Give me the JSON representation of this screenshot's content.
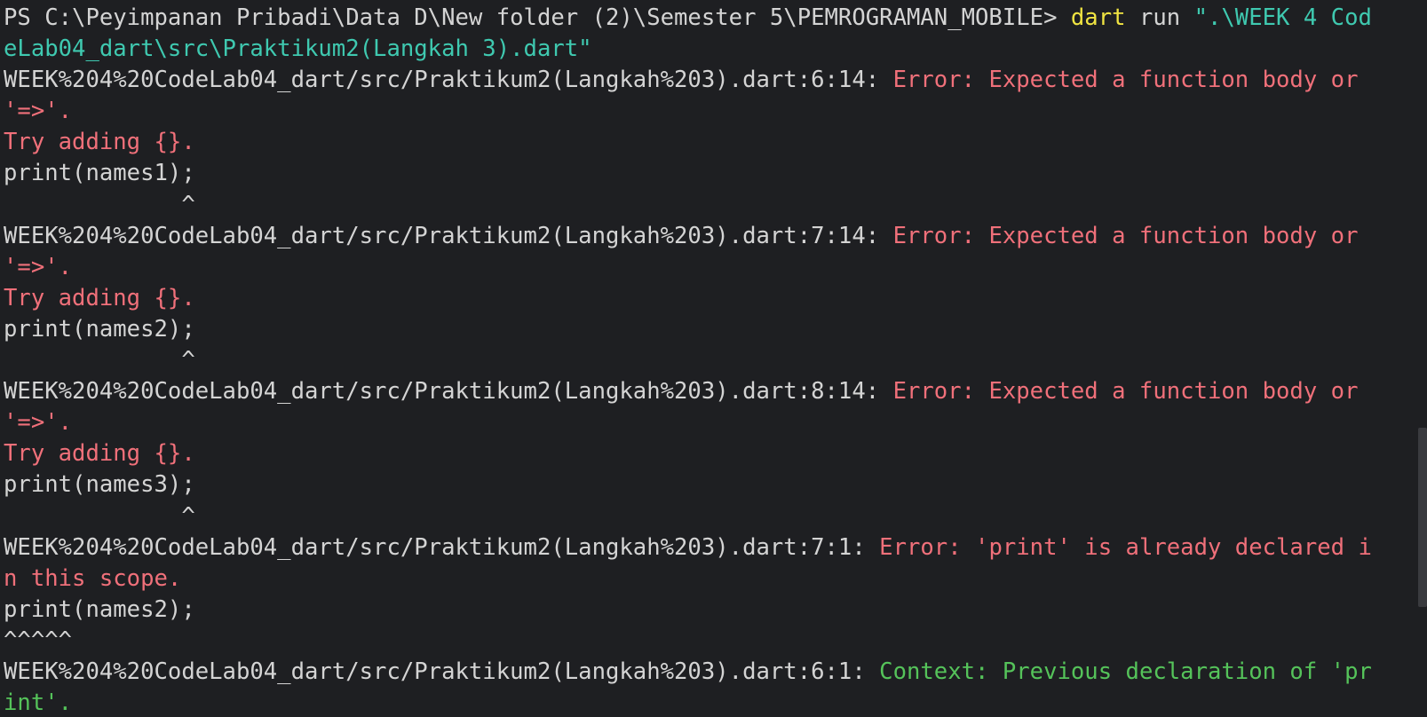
{
  "terminal": {
    "lines": [
      [
        {
          "text": "PS C:\\Peyimpanan Pribadi\\Data D\\New folder (2)\\Semester 5\\PEMROGRAMAN_MOBILE> ",
          "style": "plain"
        },
        {
          "text": "dart",
          "style": "cmd"
        },
        {
          "text": " run ",
          "style": "plain"
        },
        {
          "text": "\".\\WEEK 4 Cod",
          "style": "string"
        }
      ],
      [
        {
          "text": "eLab04_dart\\src\\Praktikum2(Langkah 3).dart\"",
          "style": "string"
        }
      ],
      [
        {
          "text": "WEEK%204%20CodeLab04_dart/src/Praktikum2(Langkah%203).dart:6:14: ",
          "style": "plain"
        },
        {
          "text": "Error: Expected a function body or",
          "style": "error"
        }
      ],
      [
        {
          "text": "'=>'.",
          "style": "error"
        }
      ],
      [
        {
          "text": "Try adding {}.",
          "style": "error"
        }
      ],
      [
        {
          "text": "print(names1);",
          "style": "plain"
        }
      ],
      [
        {
          "text": "             ^",
          "style": "plain"
        }
      ],
      [
        {
          "text": "WEEK%204%20CodeLab04_dart/src/Praktikum2(Langkah%203).dart:7:14: ",
          "style": "plain"
        },
        {
          "text": "Error: Expected a function body or",
          "style": "error"
        }
      ],
      [
        {
          "text": "'=>'.",
          "style": "error"
        }
      ],
      [
        {
          "text": "Try adding {}.",
          "style": "error"
        }
      ],
      [
        {
          "text": "print(names2);",
          "style": "plain"
        }
      ],
      [
        {
          "text": "             ^",
          "style": "plain"
        }
      ],
      [
        {
          "text": "WEEK%204%20CodeLab04_dart/src/Praktikum2(Langkah%203).dart:8:14: ",
          "style": "plain"
        },
        {
          "text": "Error: Expected a function body or",
          "style": "error"
        }
      ],
      [
        {
          "text": "'=>'.",
          "style": "error"
        }
      ],
      [
        {
          "text": "Try adding {}.",
          "style": "error"
        }
      ],
      [
        {
          "text": "print(names3);",
          "style": "plain"
        }
      ],
      [
        {
          "text": "             ^",
          "style": "plain"
        }
      ],
      [
        {
          "text": "WEEK%204%20CodeLab04_dart/src/Praktikum2(Langkah%203).dart:7:1: ",
          "style": "plain"
        },
        {
          "text": "Error: 'print' is already declared i",
          "style": "error"
        }
      ],
      [
        {
          "text": "n this scope.",
          "style": "error"
        }
      ],
      [
        {
          "text": "print(names2);",
          "style": "plain"
        }
      ],
      [
        {
          "text": "^^^^^",
          "style": "plain"
        }
      ],
      [
        {
          "text": "WEEK%204%20CodeLab04_dart/src/Praktikum2(Langkah%203).dart:6:1: ",
          "style": "plain"
        },
        {
          "text": "Context: Previous declaration of 'pr",
          "style": "context"
        }
      ],
      [
        {
          "text": "int'.",
          "style": "context"
        }
      ]
    ]
  }
}
